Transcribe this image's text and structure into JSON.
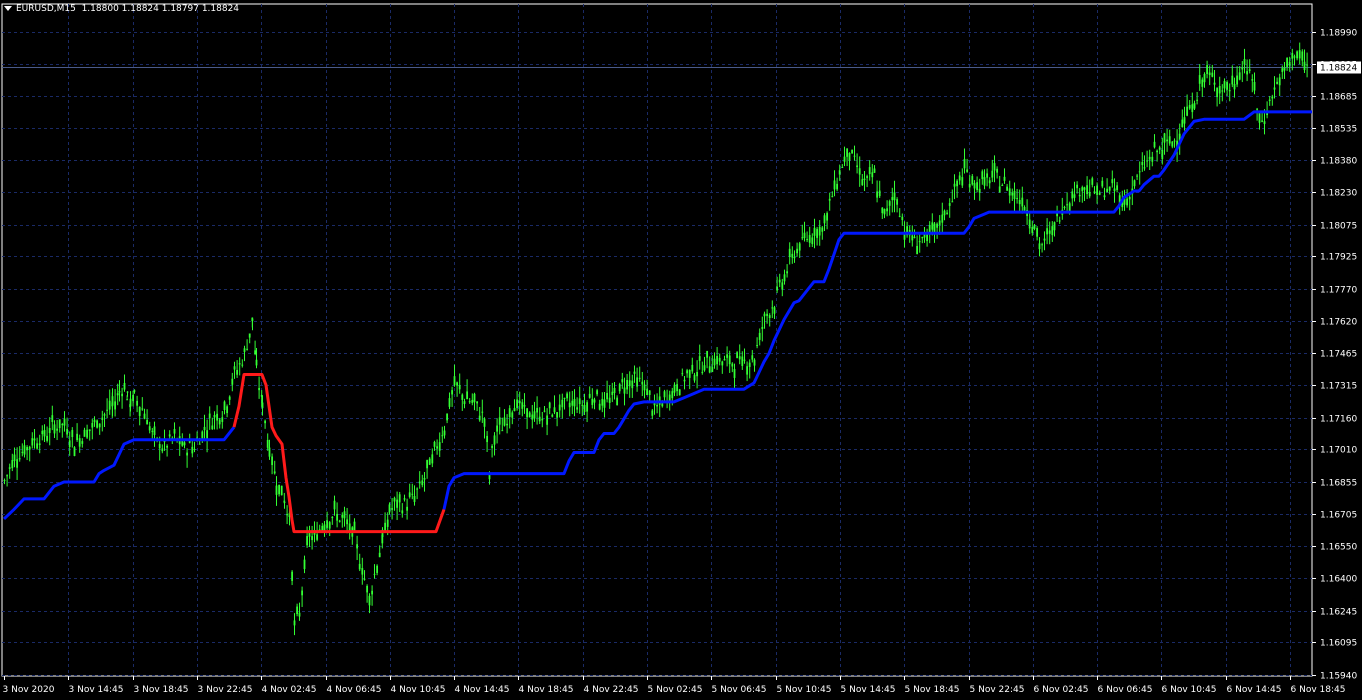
{
  "header": {
    "symbol": "EURUSD,M15",
    "ohlc": "1.18800 1.18824 1.18797 1.18824"
  },
  "current_price_label": "1.18824",
  "colors": {
    "background": "#000000",
    "grid": "#1a2a66",
    "axis": "#ffffff",
    "candle": "#33ff33",
    "indicator_up": "#0018ff",
    "indicator_down": "#ff1a1a",
    "price_line": "#4a5a8a"
  },
  "chart_data": {
    "type": "line",
    "title": "",
    "xlabel": "",
    "ylabel": "",
    "ylim": [
      1.1594,
      1.1906
    ],
    "grid": true,
    "y_ticks": [
      "1.18990",
      "1.18835",
      "1.18685",
      "1.18535",
      "1.18380",
      "1.18230",
      "1.18075",
      "1.17925",
      "1.17770",
      "1.17620",
      "1.17465",
      "1.17315",
      "1.17160",
      "1.17010",
      "1.16855",
      "1.16705",
      "1.16550",
      "1.16400",
      "1.16245",
      "1.16095",
      "1.15940"
    ],
    "x_ticks": [
      "3 Nov 2020",
      "3 Nov 14:45",
      "3 Nov 18:45",
      "3 Nov 22:45",
      "4 Nov 02:45",
      "4 Nov 06:45",
      "4 Nov 10:45",
      "4 Nov 14:45",
      "4 Nov 18:45",
      "4 Nov 22:45",
      "5 Nov 02:45",
      "5 Nov 06:45",
      "5 Nov 10:45",
      "5 Nov 14:45",
      "5 Nov 18:45",
      "5 Nov 22:45",
      "6 Nov 02:45",
      "6 Nov 06:45",
      "6 Nov 10:45",
      "6 Nov 14:45",
      "6 Nov 18:45"
    ],
    "price_series": {
      "x": [
        0,
        10,
        20,
        30,
        40,
        50,
        60,
        70,
        80,
        90,
        100,
        108,
        115,
        120,
        123,
        126,
        130,
        140,
        150,
        160,
        170,
        180,
        190,
        200,
        210,
        220,
        230,
        240,
        248,
        252,
        258,
        265,
        272,
        280,
        285,
        290,
        295,
        300,
        305,
        310,
        320,
        330,
        340,
        350,
        360,
        365,
        370,
        378,
        385,
        390,
        400,
        410,
        420,
        430,
        440,
        445,
        450,
        460,
        470,
        480,
        485,
        490,
        500,
        510,
        520,
        530,
        540,
        550,
        560,
        570,
        580,
        590,
        600,
        610,
        620,
        630,
        640,
        650,
        660,
        670,
        680,
        690,
        700,
        710,
        720,
        730,
        740,
        750,
        760,
        770,
        780,
        790,
        800,
        810,
        820,
        830,
        840,
        845,
        850,
        860,
        870,
        880,
        890,
        900,
        910,
        920,
        930,
        940,
        950,
        960,
        970,
        980,
        990,
        1000,
        1010,
        1020,
        1030,
        1035,
        1040,
        1050,
        1060,
        1070,
        1080,
        1090,
        1100,
        1110,
        1120,
        1130,
        1140,
        1150,
        1160,
        1170,
        1180,
        1190,
        1200,
        1210,
        1220,
        1230,
        1240,
        1250,
        1255,
        1260,
        1270,
        1280,
        1290,
        1300,
        1308
      ],
      "y": [
        1.1686,
        1.16975,
        1.17005,
        1.17055,
        1.17075,
        1.17125,
        1.17125,
        1.1704,
        1.17085,
        1.17125,
        1.17175,
        1.17215,
        1.17285,
        1.17315,
        1.17255,
        1.17225,
        1.1726,
        1.17185,
        1.17055,
        1.1702,
        1.17065,
        1.1702,
        1.17025,
        1.17105,
        1.17165,
        1.17195,
        1.17365,
        1.17455,
        1.17625,
        1.1738,
        1.17225,
        1.17005,
        1.1686,
        1.16775,
        1.1668,
        1.16175,
        1.16225,
        1.1646,
        1.16605,
        1.16585,
        1.16675,
        1.16705,
        1.1667,
        1.16595,
        1.16395,
        1.16305,
        1.16415,
        1.16585,
        1.16715,
        1.16745,
        1.1675,
        1.16785,
        1.16875,
        1.16995,
        1.17115,
        1.17225,
        1.17315,
        1.17255,
        1.17225,
        1.1716,
        1.16895,
        1.17085,
        1.17125,
        1.17235,
        1.1719,
        1.17165,
        1.1717,
        1.1719,
        1.17225,
        1.17235,
        1.1722,
        1.17275,
        1.17225,
        1.17265,
        1.17325,
        1.1734,
        1.17315,
        1.1719,
        1.17245,
        1.1729,
        1.17355,
        1.1739,
        1.1741,
        1.17435,
        1.17425,
        1.1742,
        1.17425,
        1.17445,
        1.17635,
        1.17705,
        1.17835,
        1.17945,
        1.18,
        1.18045,
        1.18075,
        1.18255,
        1.1839,
        1.1843,
        1.18375,
        1.18275,
        1.18305,
        1.18105,
        1.1823,
        1.1806,
        1.17995,
        1.1801,
        1.18035,
        1.18125,
        1.1823,
        1.18335,
        1.18265,
        1.18275,
        1.18305,
        1.18265,
        1.18225,
        1.18175,
        1.1807,
        1.1797,
        1.1799,
        1.1807,
        1.18175,
        1.1823,
        1.1826,
        1.1823,
        1.18235,
        1.18245,
        1.18175,
        1.18265,
        1.18355,
        1.18415,
        1.18445,
        1.18475,
        1.18575,
        1.18655,
        1.1879,
        1.18755,
        1.18715,
        1.18735,
        1.18845,
        1.18725,
        1.1855,
        1.18585,
        1.1872,
        1.18795,
        1.18895,
        1.18835,
        1.18824
      ]
    },
    "indicator_series": {
      "x": [
        0,
        10,
        20,
        30,
        40,
        50,
        60,
        70,
        80,
        90,
        95,
        100,
        110,
        120,
        130,
        140,
        150,
        160,
        170,
        180,
        190,
        200,
        210,
        220,
        230,
        235,
        240,
        250,
        258,
        262,
        268,
        272,
        278,
        282,
        285,
        288,
        290,
        295,
        300,
        320,
        340,
        360,
        380,
        400,
        420,
        430,
        432,
        440,
        445,
        450,
        460,
        480,
        500,
        520,
        540,
        560,
        565,
        570,
        580,
        590,
        595,
        600,
        610,
        615,
        620,
        625,
        630,
        640,
        650,
        660,
        670,
        680,
        690,
        700,
        705,
        710,
        720,
        730,
        740,
        750,
        755,
        760,
        765,
        770,
        780,
        790,
        795,
        800,
        810,
        820,
        825,
        830,
        835,
        840,
        860,
        880,
        900,
        920,
        940,
        960,
        965,
        970,
        980,
        985,
        990,
        1000,
        1020,
        1040,
        1060,
        1080,
        1100,
        1110,
        1115,
        1120,
        1130,
        1135,
        1140,
        1150,
        1155,
        1160,
        1170,
        1180,
        1185,
        1190,
        1200,
        1205,
        1210,
        1220,
        1230,
        1240,
        1250,
        1260,
        1270,
        1280,
        1290,
        1300,
        1308
      ],
      "y": [
        1.1668,
        1.16725,
        1.16775,
        1.16775,
        1.16775,
        1.16835,
        1.16855,
        1.16855,
        1.16855,
        1.16855,
        1.16895,
        1.1691,
        1.16935,
        1.17035,
        1.17055,
        1.17055,
        1.17055,
        1.17055,
        1.17055,
        1.17055,
        1.17055,
        1.17055,
        1.17055,
        1.17055,
        1.17115,
        1.17215,
        1.17365,
        1.17365,
        1.17365,
        1.17315,
        1.17115,
        1.17075,
        1.17035,
        1.16875,
        1.16785,
        1.16675,
        1.1662,
        1.1662,
        1.1662,
        1.1662,
        1.1662,
        1.1662,
        1.1662,
        1.1662,
        1.1662,
        1.1662,
        1.1662,
        1.16725,
        1.16835,
        1.16875,
        1.16895,
        1.16895,
        1.16895,
        1.16895,
        1.16895,
        1.16895,
        1.16955,
        1.16995,
        1.16995,
        1.16995,
        1.17055,
        1.17085,
        1.17085,
        1.17115,
        1.17155,
        1.17195,
        1.17225,
        1.17235,
        1.17235,
        1.17235,
        1.17235,
        1.17255,
        1.17275,
        1.17295,
        1.17295,
        1.17295,
        1.17295,
        1.17295,
        1.17295,
        1.17325,
        1.17375,
        1.17425,
        1.17465,
        1.17525,
        1.17625,
        1.17705,
        1.17715,
        1.17745,
        1.17805,
        1.17805,
        1.17865,
        1.17935,
        1.18005,
        1.18035,
        1.18035,
        1.18035,
        1.18035,
        1.18035,
        1.18035,
        1.18035,
        1.18065,
        1.18105,
        1.18125,
        1.18135,
        1.18135,
        1.18135,
        1.18135,
        1.18135,
        1.18135,
        1.18135,
        1.18135,
        1.18135,
        1.18165,
        1.18205,
        1.18235,
        1.18235,
        1.18265,
        1.18305,
        1.18305,
        1.18335,
        1.18405,
        1.18505,
        1.18535,
        1.18565,
        1.18575,
        1.18575,
        1.18575,
        1.18575,
        1.18575,
        1.18575,
        1.1861,
        1.1861,
        1.1861,
        1.1861,
        1.1861,
        1.1861,
        1.1861
      ],
      "down_segment_index_range": [
        24,
        47
      ]
    }
  }
}
